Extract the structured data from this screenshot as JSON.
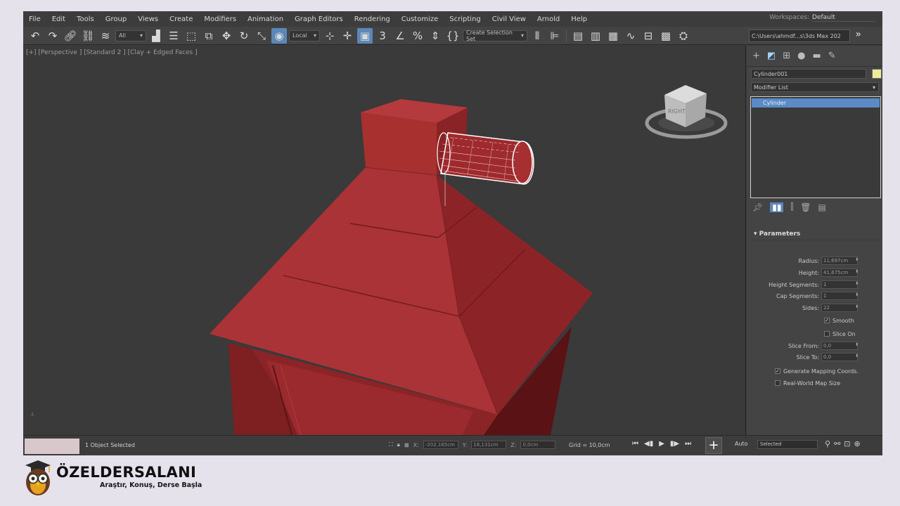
{
  "menubar": {
    "items": [
      "File",
      "Edit",
      "Tools",
      "Group",
      "Views",
      "Create",
      "Modifiers",
      "Animation",
      "Graph Editors",
      "Rendering",
      "Customize",
      "Scripting",
      "Civil View",
      "Arnold",
      "Help"
    ],
    "workspace_label": "Workspaces:",
    "workspace_value": "Default"
  },
  "toolbar": {
    "filter_value": "All",
    "coord_system": "Local",
    "selection_set": "Create Selection Set",
    "project_path": "C:\\Users\\ahmdf...s\\3ds Max 202"
  },
  "viewport": {
    "label": "[+] [Perspective ] [Standard 2 ] [Clay + Edged Faces ]",
    "model_color": "#9c2a2d",
    "selection_color": "#ffffff"
  },
  "command_panel": {
    "object_name": "Cylinder001",
    "modifier_list": "Modifier List",
    "stack_item": "Cylinder",
    "params_title": "Parameters",
    "params": [
      {
        "label": "Radius:",
        "value": "11,697cm"
      },
      {
        "label": "Height:",
        "value": "41,675cm"
      },
      {
        "label": "Height Segments:",
        "value": "1"
      },
      {
        "label": "Cap Segments:",
        "value": "1"
      },
      {
        "label": "Sides:",
        "value": "22"
      }
    ],
    "smooth_label": "Smooth",
    "slice_on_label": "Slice On",
    "slice_from_label": "Slice From:",
    "slice_from_value": "0,0",
    "slice_to_label": "Slice To:",
    "slice_to_value": "0,0",
    "gen_mapping_label": "Generate Mapping Coords.",
    "real_world_label": "Real-World Map Size"
  },
  "statusbar": {
    "status_text": "1 Object Selected",
    "x_label": "X:",
    "x_value": "-202,165cm",
    "y_label": "Y:",
    "y_value": "18,131cm",
    "z_label": "Z:",
    "z_value": "0,0cm",
    "grid_text": "Grid = 10,0cm",
    "auto_label": "Auto",
    "selected_value": "Selected"
  },
  "logo": {
    "title": "ÖZELDERSALANI",
    "tagline": "Araştır, Konuş, Derse Başla"
  }
}
